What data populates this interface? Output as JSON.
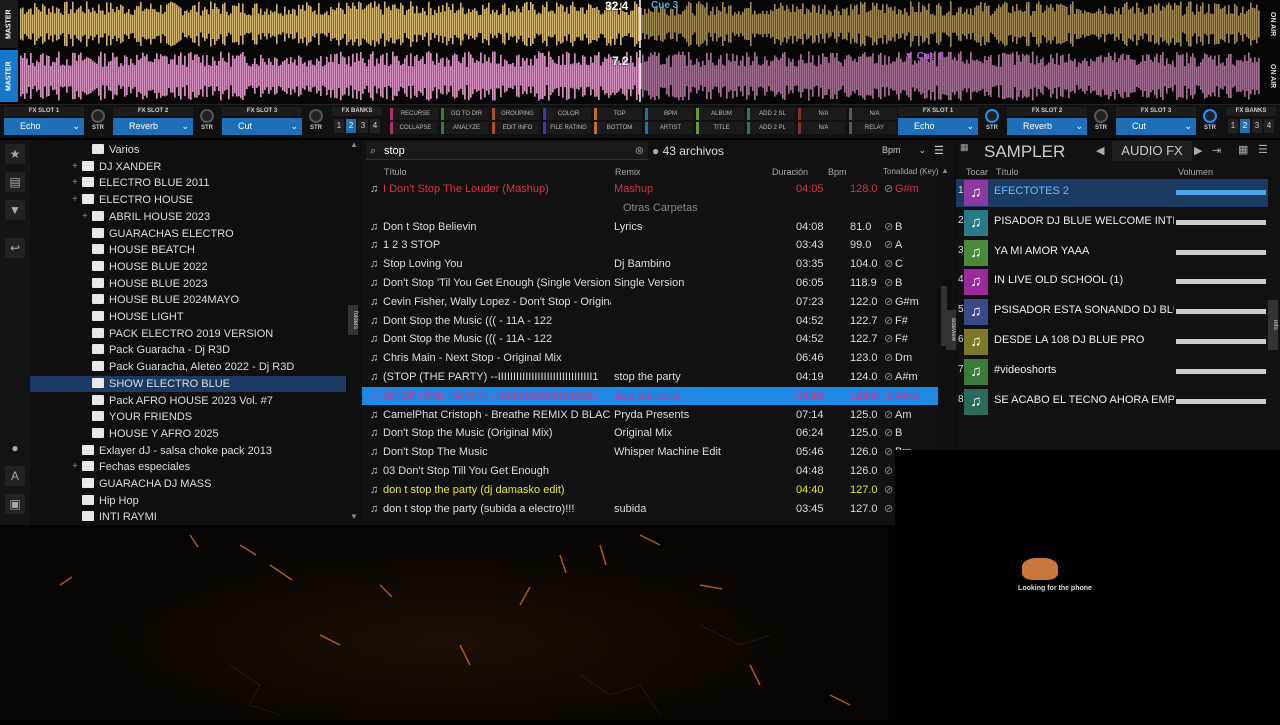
{
  "deck_labels": {
    "top": "MASTER",
    "bottom": "MASTER",
    "on_air_top": "ON AIR",
    "on_air_bottom": "ON AIR"
  },
  "deck1": {
    "position": "32.4",
    "cue": "Cue 3"
  },
  "deck2": {
    "position": "7.2",
    "cue": "Cue 8"
  },
  "fx_left": [
    {
      "label": "FX SLOT 1",
      "value": "Echo"
    },
    {
      "label": "FX SLOT 2",
      "value": "Reverb"
    },
    {
      "label": "FX SLOT 3",
      "value": "Cut"
    }
  ],
  "fx_right": [
    {
      "label": "FX SLOT 1",
      "value": "Echo"
    },
    {
      "label": "FX SLOT 2",
      "value": "Reverb"
    },
    {
      "label": "FX SLOT 3",
      "value": "Cut"
    }
  ],
  "str_label": "STR",
  "fx_banks_label": "FX BANKS",
  "bank_numbers": [
    "1",
    "2",
    "3",
    "4"
  ],
  "sort_buttons": [
    {
      "top": "RECURSE",
      "bottom": "COLLAPSE"
    },
    {
      "top": "GO TO DIR",
      "bottom": "ANALYZE"
    },
    {
      "top": "GROUPING",
      "bottom": "EDIT INFO"
    },
    {
      "top": "COLOR",
      "bottom": "FILE RATING"
    },
    {
      "top": "TOP",
      "bottom": "BOTTOM"
    },
    {
      "top": "BPM",
      "bottom": "ARTIST"
    },
    {
      "top": "ALBUM",
      "bottom": "TITLE"
    },
    {
      "top": "ADD 2 SL",
      "bottom": "ADD 2 PL"
    },
    {
      "top": "N/A",
      "bottom": "N/A"
    },
    {
      "top": "N/A",
      "bottom": "RELAY"
    }
  ],
  "tree": [
    {
      "label": "Varios",
      "level": 2,
      "plus": false
    },
    {
      "label": "DJ XANDER",
      "level": 1,
      "plus": true
    },
    {
      "label": "ELECTRO BLUE 2011",
      "level": 1,
      "plus": true
    },
    {
      "label": "ELECTRO HOUSE",
      "level": 1,
      "plus": true
    },
    {
      "label": "ABRIL  HOUSE 2023",
      "level": 2,
      "plus": true
    },
    {
      "label": "GUARACHAS ELECTRO",
      "level": 2,
      "plus": false
    },
    {
      "label": "HOUSE BEATCH",
      "level": 2,
      "plus": false
    },
    {
      "label": "HOUSE BLUE 2022",
      "level": 2,
      "plus": false
    },
    {
      "label": "HOUSE BLUE 2023",
      "level": 2,
      "plus": false
    },
    {
      "label": "HOUSE BLUE 2024MAYO",
      "level": 2,
      "plus": false
    },
    {
      "label": "HOUSE LIGHT",
      "level": 2,
      "plus": false
    },
    {
      "label": "PACK ELECTRO 2019 VERSION",
      "level": 2,
      "plus": false
    },
    {
      "label": "Pack Guaracha - Dj R3D",
      "level": 2,
      "plus": false
    },
    {
      "label": "Pack Guaracha, Aleteo 2022 - Dj R3D",
      "level": 2,
      "plus": false
    },
    {
      "label": "SHOW ELECTRO BLUE",
      "level": 2,
      "plus": false,
      "selected": true
    },
    {
      "label": "Pack AFRO HOUSE 2023 Vol. #7",
      "level": 2,
      "plus": false
    },
    {
      "label": "YOUR FRIENDS",
      "level": 2,
      "plus": false
    },
    {
      "label": "HOUSE Y AFRO 2025",
      "level": 2,
      "plus": false
    },
    {
      "label": "Exlayer dJ - salsa choke pack 2013",
      "level": 1,
      "plus": false
    },
    {
      "label": "Fechas especiales",
      "level": 1,
      "plus": true
    },
    {
      "label": "GUARACHA DJ MASS",
      "level": 1,
      "plus": false
    },
    {
      "label": "Hip Hop",
      "level": 1,
      "plus": false
    },
    {
      "label": "INTI RAYMI",
      "level": 1,
      "plus": false
    }
  ],
  "search": {
    "value": "stop",
    "count": "43 archivos"
  },
  "columns": {
    "title": "Título",
    "remix": "Remix",
    "duration": "Duración",
    "bpm": "Bpm",
    "key": "Tonalidad (Key)",
    "sort_field": "Bpm"
  },
  "other_folders": "Otras Carpetas",
  "tracks": [
    {
      "title": "I Don't Stop The Louder (Mashup)",
      "remix": "Mashup",
      "dur": "04:05",
      "bpm": "128.0",
      "key": "G#m",
      "color": "#d8324a"
    },
    {
      "title": "Don t Stop Believin",
      "remix": "Lyrics",
      "dur": "04:08",
      "bpm": "81.0",
      "key": "B"
    },
    {
      "title": "1 2 3 STOP",
      "remix": "",
      "dur": "03:43",
      "bpm": "99.0",
      "key": "A"
    },
    {
      "title": "Stop Loving You",
      "remix": "Dj Bambino",
      "dur": "03:35",
      "bpm": "104.0",
      "key": "C"
    },
    {
      "title": "Don't Stop 'Til You Get Enough (Single Version)",
      "remix": "Single Version",
      "dur": "06:05",
      "bpm": "118.9",
      "key": "B"
    },
    {
      "title": "Cevin Fisher, Wally Lopez - Don't Stop - Original Mix",
      "remix": "",
      "dur": "07:23",
      "bpm": "122.0",
      "key": "G#m"
    },
    {
      "title": "Dont Stop the Music ((( - 11A - 122",
      "remix": "",
      "dur": "04:52",
      "bpm": "122.7",
      "key": "F#"
    },
    {
      "title": "Dont Stop the Music ((( - 11A - 122",
      "remix": "",
      "dur": "04:52",
      "bpm": "122.7",
      "key": "F#"
    },
    {
      "title": "Chris Main - Next Stop - Original Mix",
      "remix": "",
      "dur": "06:46",
      "bpm": "123.0",
      "key": "Dm"
    },
    {
      "title": "(STOP (THE PARTY) --IIIIIIIIIIIIIIIIIIIIIIIIIIIIIII1",
      "remix": "stop the party",
      "dur": "04:19",
      "bpm": "124.0",
      "key": "A#m"
    },
    {
      "title": "(STOP (THE PARTY) --IIIIIIIIIIIIIIIIIIIIIIIIIIIIIII1",
      "remix": "stop the party",
      "dur": "04:19",
      "bpm": "124.0",
      "key": "A#m",
      "selected": true
    },
    {
      "title": "CamelPhat  Cristoph - Breathe REMIX D BLACK INICIO",
      "remix": "Pryda Presents",
      "dur": "07:14",
      "bpm": "125.0",
      "key": "Am"
    },
    {
      "title": "Don't Stop the Music (Original Mix)",
      "remix": "Original Mix",
      "dur": "06:24",
      "bpm": "125.0",
      "key": "B"
    },
    {
      "title": "Don't Stop The Music",
      "remix": "Whisper Machine Edit",
      "dur": "05:46",
      "bpm": "126.0",
      "key": "Bm"
    },
    {
      "title": "03 Don't Stop Till You Get Enough",
      "remix": "",
      "dur": "04:48",
      "bpm": "126.0",
      "key": ""
    },
    {
      "title": "don t stop the party (dj damasko edit)",
      "remix": "",
      "dur": "04:40",
      "bpm": "127.0",
      "key": "",
      "color": "#e8e820"
    },
    {
      "title": "don t stop the party (subida a electro)!!!",
      "remix": "subida",
      "dur": "03:45",
      "bpm": "127.0",
      "key": ""
    }
  ],
  "sampler": {
    "title": "SAMPLER",
    "mode": "AUDIO FX",
    "col_play": "Tocar",
    "col_title": "Título",
    "col_volume": "Volumen",
    "items": [
      {
        "n": "1",
        "name": "EFECTOTES 2",
        "color": "#8a3aa0",
        "active": true
      },
      {
        "n": "2",
        "name": "PISADOR DJ BLUE WELCOME INTRO",
        "color": "#2a7a88"
      },
      {
        "n": "3",
        "name": "YA MI AMOR YAAA",
        "color": "#4a8a3a"
      },
      {
        "n": "4",
        "name": "IN LIVE OLD SCHOOL (1)",
        "color": "#9a2a9a"
      },
      {
        "n": "5",
        "name": "PSISADOR ESTA SONANDO DJ BLUE",
        "color": "#3a4a88"
      },
      {
        "n": "6",
        "name": "DESDE LA 108 DJ BLUE PRO",
        "color": "#7a7a2a"
      },
      {
        "n": "7",
        "name": "#videoshorts",
        "color": "#3a7a3a"
      },
      {
        "n": "8",
        "name": "SE ACABO EL TECNO AHORA EMPIEZA EL PERRE...",
        "color": "#2a6a5a"
      }
    ]
  },
  "side_tabs": {
    "folders": "folders",
    "sideview": "sideview",
    "info": "info"
  },
  "phone_overlay": {
    "text": "Looking for the phone"
  },
  "colors": {
    "accent": "#1f6fb8",
    "selected_row": "#1e88e5",
    "deck2_label": "#1676c7"
  }
}
